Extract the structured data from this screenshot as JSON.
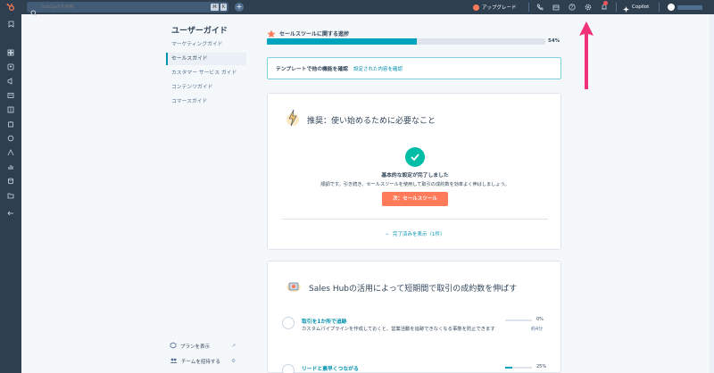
{
  "colors": {
    "topbar": "#2e3f50",
    "accent": "#ff7a59",
    "teal": "#00a4bd",
    "link": "#0091ae",
    "check": "#00bda5",
    "annotation_arrow": "#f2317b"
  },
  "topbar": {
    "search_placeholder": "HubSpotを検索",
    "shortcut_key1": "⌘",
    "shortcut_key2": "K",
    "upgrade_label": "アップグレード",
    "copilot_label": "Copilot",
    "icons": [
      "hubspot-logo-icon",
      "search-icon",
      "plus-icon",
      "phone-icon",
      "marketplace-icon",
      "help-icon",
      "settings-icon",
      "notifications-icon",
      "copilot-icon"
    ]
  },
  "sidebar": {
    "title": "ユーザーガイド",
    "items": [
      {
        "label": "マーケティングガイド"
      },
      {
        "label": "セールスガイド"
      },
      {
        "label": "カスタマー サービス ガイド"
      },
      {
        "label": "コンテンツガイド"
      },
      {
        "label": "コマースガイド"
      }
    ],
    "active_index": 1,
    "footer": {
      "view_plan": "プランを表示",
      "invite_team": "チームを招待する"
    }
  },
  "progress": {
    "title": "セールスツールに関する進捗",
    "percent_label": "54%",
    "percent": 54
  },
  "template_banner": {
    "text": "テンプレートで他の機能を確認",
    "link": "設定された内容を確認"
  },
  "recommend_card": {
    "title": "推奨：使い始めるために必要なこと",
    "done_title": "基本的な設定が完了しました",
    "done_desc": "順調です。引き続き、セールスツールを使用して取引の成約数を効率よく伸ばしましょう。",
    "next_button": "次：セールスツール",
    "show_completed": "完了済みを表示（1件）"
  },
  "sales_card": {
    "title": "Sales Hubの活用によって短期間で取引の成約数を伸ばす",
    "tasks": [
      {
        "title": "取引を1か所で追跡",
        "desc": "カスタムパイプラインを作成しておくと、営業活動を追跡できなくなる事態を防止できます",
        "percent_label": "0%",
        "percent": 0,
        "time": "約4分"
      },
      {
        "title": "リードと素早くつながる",
        "desc": "",
        "percent_label": "25%",
        "percent": 25,
        "time": ""
      }
    ]
  }
}
